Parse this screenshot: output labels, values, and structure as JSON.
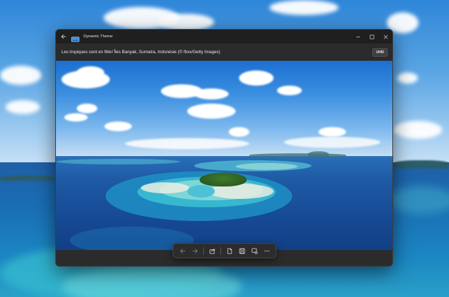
{
  "window": {
    "title": "Dynamic Theme",
    "caption": "Les tropiques sont en fête! Îles Banyak, Sumatra, Indonésie (© fbxx/Getty Images)",
    "badge": "UHD"
  },
  "titlebar_icons": [
    "back-arrow-icon",
    "app-icon",
    "minimize-icon",
    "maximize-icon",
    "close-icon"
  ],
  "toolbar": {
    "items": [
      "previous-icon",
      "next-icon",
      "share-icon",
      "page-icon",
      "save-icon",
      "set-background-icon",
      "more-icon"
    ],
    "disabled": [
      "previous-icon",
      "next-icon"
    ]
  },
  "colors": {
    "window_bg": "#202020",
    "bar_bg": "#2b2b2b",
    "text": "#e8e8e8"
  }
}
